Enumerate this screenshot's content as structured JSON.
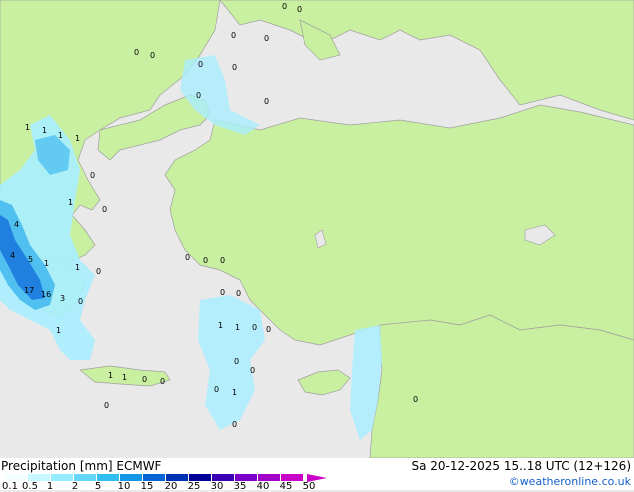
{
  "title": "Precipitation [mm]  ECMWF",
  "valid_time": "Sa 20-12-2025 15..18 UTC (12+126)",
  "credit": "©weatheronline.co.uk",
  "colors": {
    "land": "#c8f0a0",
    "sea": "#e9e9e9",
    "border": "#a0a0a0",
    "precip_light": "#aaeeff",
    "precip_mid": "#50c0f0",
    "precip_heavy": "#2080e0"
  },
  "legend": {
    "ticks": [
      "0.1",
      "0.5",
      "1",
      "2",
      "5",
      "10",
      "15",
      "20",
      "25",
      "30",
      "35",
      "40",
      "45",
      "50"
    ],
    "colors": [
      "#f4ffff",
      "#c8f8ff",
      "#96ecff",
      "#64d6f8",
      "#32bef0",
      "#1496e6",
      "#0064d2",
      "#0032b4",
      "#000096",
      "#3c00b4",
      "#7800c8",
      "#a000c8",
      "#c800c8"
    ]
  },
  "map_labels": [
    {
      "text": "1"
    },
    {
      "text": "1"
    },
    {
      "text": "1"
    },
    {
      "text": "1"
    },
    {
      "text": "4"
    },
    {
      "text": "4"
    },
    {
      "text": "5"
    },
    {
      "text": "1"
    },
    {
      "text": "17"
    },
    {
      "text": "16"
    },
    {
      "text": "3"
    },
    {
      "text": "1"
    },
    {
      "text": "1"
    },
    {
      "text": "1"
    },
    {
      "text": "1"
    },
    {
      "text": "1"
    },
    {
      "text": "1"
    },
    {
      "text": "1"
    },
    {
      "text": "1"
    },
    {
      "text": "0"
    },
    {
      "text": "0"
    },
    {
      "text": "0"
    },
    {
      "text": "0"
    },
    {
      "text": "0"
    },
    {
      "text": "0"
    },
    {
      "text": "0"
    },
    {
      "text": "0"
    },
    {
      "text": "0"
    },
    {
      "text": "0"
    },
    {
      "text": "0"
    },
    {
      "text": "0"
    },
    {
      "text": "0"
    },
    {
      "text": "0"
    },
    {
      "text": "0"
    },
    {
      "text": "0"
    },
    {
      "text": "0"
    },
    {
      "text": "0"
    },
    {
      "text": "0"
    },
    {
      "text": "0"
    },
    {
      "text": "0"
    },
    {
      "text": "0"
    },
    {
      "text": "0"
    },
    {
      "text": "0"
    },
    {
      "text": "0"
    },
    {
      "text": "0"
    },
    {
      "text": "0"
    },
    {
      "text": "0"
    },
    {
      "text": "0"
    }
  ]
}
